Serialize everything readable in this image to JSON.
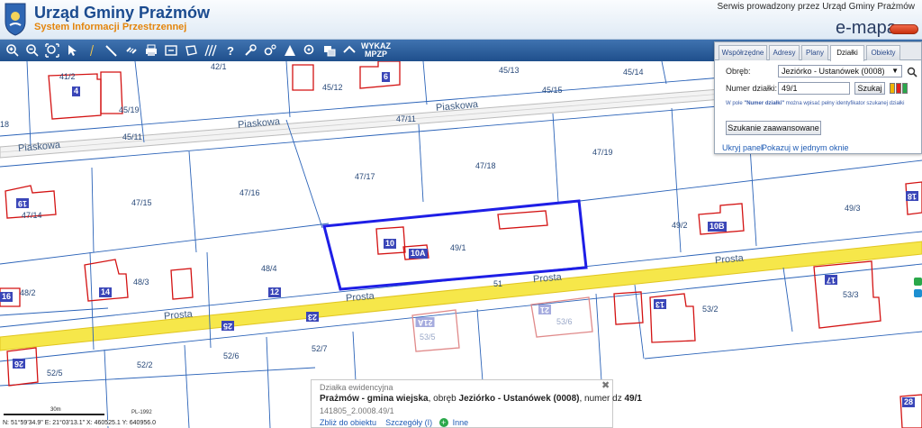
{
  "header": {
    "title": "Urząd Gminy Prażmów",
    "subtitle": "System Informacji Przestrzennej",
    "serwis": "Serwis prowadzony przez Urząd Gminy Prażmów",
    "brand": "e-mapa"
  },
  "toolbar": {
    "wykaz_line1": "WYKAZ",
    "wykaz_line2": "MPZP"
  },
  "map": {
    "parcels": [
      "41/2",
      "42/1",
      "45/12",
      "45/13",
      "45/14",
      "45/15",
      "45/19",
      "45/11",
      "47/11",
      "47/17",
      "47/18",
      "47/19",
      "47/15",
      "47/16",
      "47/14",
      "49/1",
      "49/2",
      "49/3",
      "48/4",
      "48/3",
      "48/2",
      "53/3",
      "53/2",
      "53/5",
      "53/6",
      "52/7",
      "52/6",
      "52/2",
      "52/5",
      "18",
      "51"
    ],
    "house_numbers": [
      "4",
      "6",
      "19",
      "10",
      "10A",
      "10B",
      "16",
      "14",
      "12",
      "17",
      "13",
      "18",
      "25",
      "23",
      "21A",
      "21",
      "26",
      "28"
    ],
    "roads": [
      "Piaskowa",
      "Piaskowa",
      "Piaskowa",
      "Prosta",
      "Prosta",
      "Prosta",
      "Prosta"
    ]
  },
  "panel": {
    "tabs": [
      "Współrzędne",
      "Adresy",
      "Plany",
      "Działki",
      "Obiekty"
    ],
    "active_tab": "Działki",
    "obreb_label": "Obręb:",
    "obreb_value": "Jeziórko - Ustanówek (0008)",
    "numer_label": "Numer działki:",
    "numer_value": "49/1",
    "search_button": "Szukaj",
    "hint_prefix": "W pole ",
    "hint_bold": "\"Numer działki\"",
    "hint_suffix": " można wpisać pełny identyfikator szukanej działki",
    "advanced_button": "Szukanie zaawansowane",
    "hide_link": "Ukryj panel",
    "window_link": "Pokazuj w jednym oknie"
  },
  "info": {
    "header": "Działka ewidencyjna",
    "gmina": "Prażmów - gmina wiejska",
    "obreb_text": ", obręb ",
    "obreb": "Jeziórko - Ustanówek (0008)",
    "numer_text": ", numer dz ",
    "numer": "49/1",
    "id": "141805_2.0008.49/1",
    "link1": "Zbliż do obiektu",
    "link2": "Szczegóły (I)",
    "link3": "Inne"
  },
  "status": {
    "scale_label": "30m",
    "crs": "PL-1992",
    "coords": "N: 51°59'34.9\" E: 21°03'13.1\" X: 460525.1 Y: 640956.0"
  },
  "colors": {
    "toolbar_blue": "#1f4f8c",
    "parcel_line": "#2b63b8",
    "building_red": "#d31212",
    "selection_blue": "#1e1ee6",
    "road_yellow": "#f6e74a",
    "house_badge": "#3a46b8",
    "title_blue": "#1b4b8f",
    "subtitle_orange": "#e4850c"
  },
  "icons": [
    "zoom-in-icon",
    "zoom-out-icon",
    "zoom-extent-icon",
    "select-icon",
    "info-icon",
    "measure-icon",
    "link-icon",
    "print-icon",
    "export-icon",
    "polygon-icon",
    "hatch-icon",
    "help-icon",
    "wrench-icon",
    "settings-icon",
    "triangle-icon",
    "search-icon",
    "layers-icon",
    "chevron-icon",
    "close-icon",
    "plus-icon"
  ]
}
